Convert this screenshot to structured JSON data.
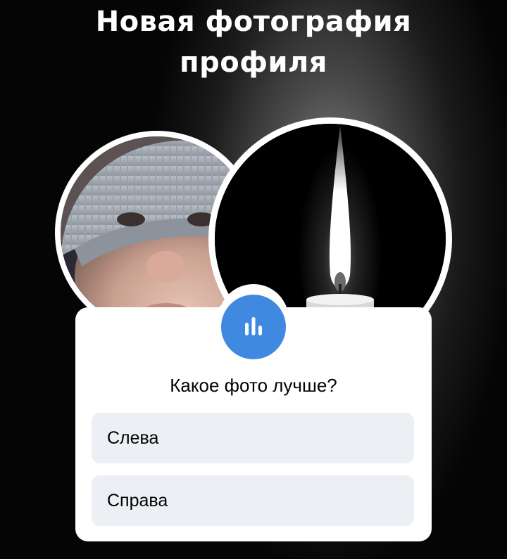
{
  "header": {
    "title_line1": "Новая фотография",
    "title_line2": "профиля"
  },
  "photos": {
    "left": "child-photo",
    "right": "candle-photo"
  },
  "poll": {
    "icon": "poll-chart-icon",
    "question": "Какое фото лучше?",
    "options": [
      {
        "label": "Слева"
      },
      {
        "label": "Справа"
      }
    ]
  },
  "colors": {
    "accent": "#3f8ae0",
    "option_bg": "#ecf0f5",
    "card_bg": "#ffffff"
  }
}
